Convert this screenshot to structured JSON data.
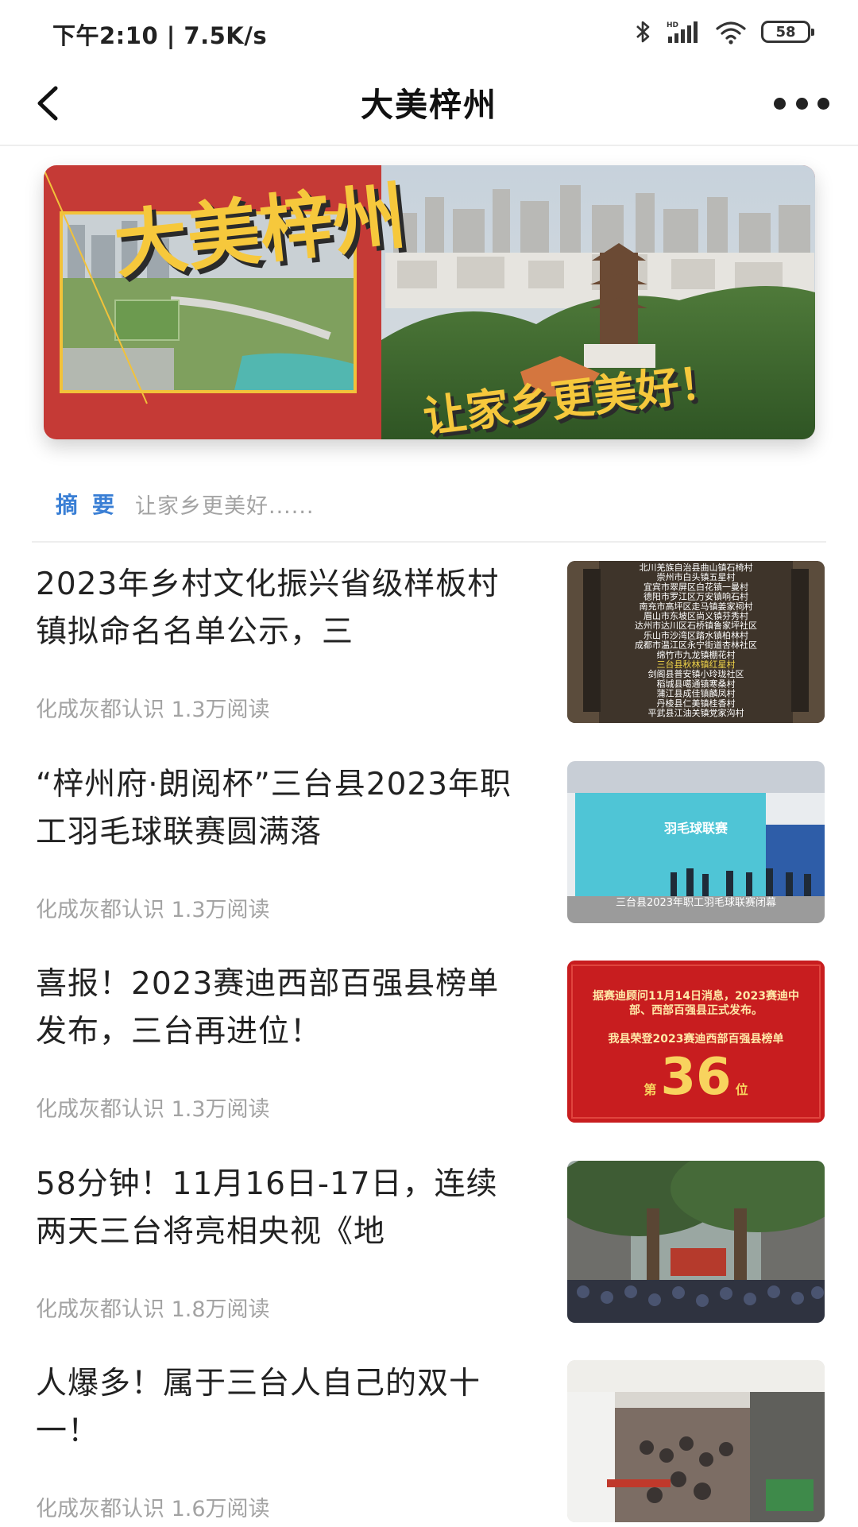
{
  "status_bar": {
    "time_speed": "下午2:10 | 7.5K/s",
    "icons": [
      "bluetooth-icon",
      "hd-signal-icon",
      "wifi-icon",
      "battery-icon"
    ],
    "battery": "58"
  },
  "nav": {
    "back_icon": "chevron-left-icon",
    "title": "大美梓州",
    "more_icon": "more-dots-icon"
  },
  "banner": {
    "main_text": "大美梓州",
    "sub_text": "让家乡更美好！"
  },
  "summary": {
    "label": "摘要",
    "text": "让家乡更美好......"
  },
  "articles": [
    {
      "title": "2023年乡村文化振兴省级样板村镇拟命名名单公示，三",
      "meta": "化成灰都认识 1.3万阅读",
      "thumb_lines": [
        "北川羌族自治县曲山镇石椅村",
        "崇州市白头镇五星村",
        "宜宾市翠屏区白花镇一曼村",
        "德阳市罗江区万安镇响石村",
        "南充市高坪区走马镇姜家祠村",
        "眉山市东坡区尚义镇芬秀村",
        "达州市达川区石桥镇鲁家坪社区",
        "乐山市沙湾区踏水镇柏林村",
        "成都市温江区永宁街道杏林社区",
        "绵竹市九龙镇棚花村",
        "三台县秋林镇红星村",
        "剑阁县普安镇小玲珑社区",
        "稻城县噶通镇寒桑村",
        "蒲江县成佳镇麟凤村",
        "丹棱县仁美镇桂香村",
        "平武县江油关镇党家沟村"
      ]
    },
    {
      "title": "“梓州府·朗阅杯”三台县2023年职工羽毛球联赛圆满落",
      "meta": "化成灰都认识 1.3万阅读",
      "thumb_caption": "三台县2023年职工羽毛球联赛闭幕"
    },
    {
      "title": "喜报！2023赛迪西部百强县榜单发布，三台再进位！",
      "meta": "化成灰都认识 1.3万阅读",
      "thumb_text1": "据赛迪顾问11月14日消息，2023赛迪中部、西部百强县正式发布。",
      "thumb_text2": "我县荣登2023赛迪西部百强县榜单",
      "thumb_prefix": "第",
      "thumb_number": "36",
      "thumb_suffix": "位"
    },
    {
      "title": "58分钟！11月16日-17日，连续两天三台将亮相央视《地",
      "meta": "化成灰都认识 1.8万阅读"
    },
    {
      "title": "人爆多！属于三台人自己的双十一！",
      "meta": "化成灰都认识 1.6万阅读"
    }
  ]
}
